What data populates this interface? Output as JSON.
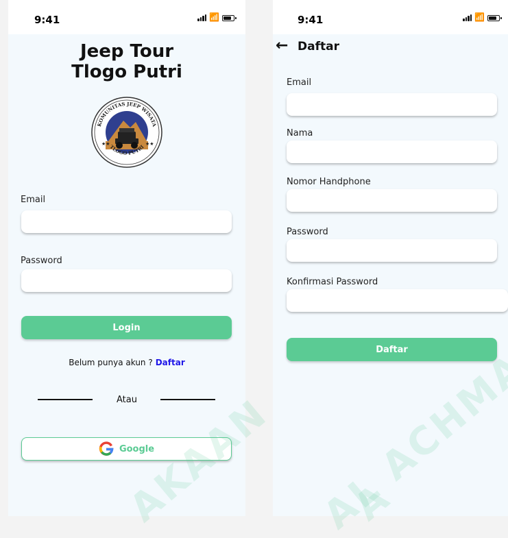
{
  "colors": {
    "accent": "#5bcb94",
    "link": "#1f17e8",
    "screen_bg": "#f3f9fd"
  },
  "status_bar": {
    "time": "9:41",
    "icons": [
      "signal-icon",
      "wifi-icon",
      "battery-icon"
    ]
  },
  "login": {
    "title_line1": "Jeep Tour",
    "title_line2": "Tlogo Putri",
    "logo_text_top": "KOMUNITAS JEEP WISATA",
    "logo_text_bottom": "TLOGO PUTRI",
    "email_label": "Email",
    "email_value": "",
    "password_label": "Password",
    "password_value": "",
    "login_button": "Login",
    "signup_prompt": "Belum punya akun ?",
    "signup_link": "Daftar",
    "or_text": "Atau",
    "google_button": "Google"
  },
  "register": {
    "nav_title": "Daftar",
    "email_label": "Email",
    "name_label": "Nama",
    "phone_label": "Nomor Handphone",
    "password_label": "Password",
    "confirm_label": "Konfirmasi Password",
    "submit_button": "Daftar"
  },
  "watermark": {
    "lines": [
      "AKAAN",
      "AL ACHMAD YA",
      "A"
    ]
  }
}
